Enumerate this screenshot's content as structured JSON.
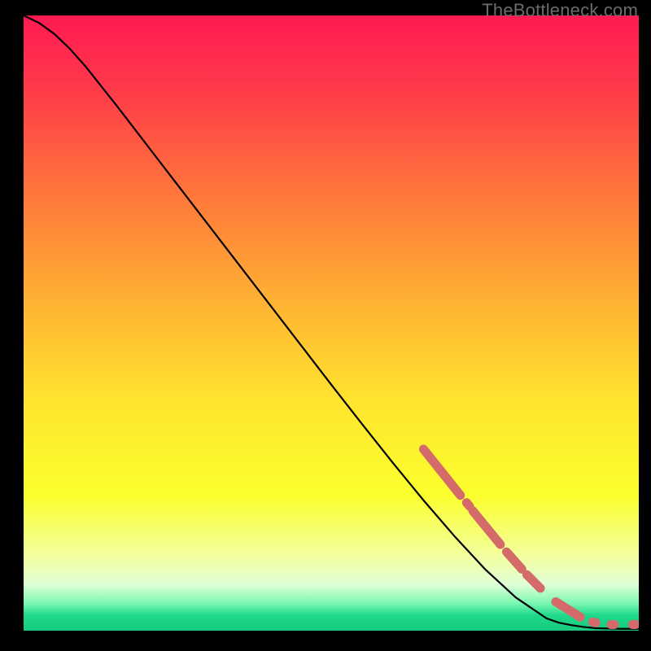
{
  "watermark": "TheBottleneck.com",
  "chart_data": {
    "type": "line",
    "title": "",
    "xlabel": "",
    "ylabel": "",
    "xlim": [
      0,
      100
    ],
    "ylim": [
      0,
      100
    ],
    "grid": false,
    "legend": false,
    "gradient_stops": [
      {
        "offset": 0.0,
        "color": "#ff1a52"
      },
      {
        "offset": 0.12,
        "color": "#ff3a4a"
      },
      {
        "offset": 0.3,
        "color": "#ff7a3a"
      },
      {
        "offset": 0.48,
        "color": "#ffb733"
      },
      {
        "offset": 0.63,
        "color": "#ffe52e"
      },
      {
        "offset": 0.78,
        "color": "#fbff2d"
      },
      {
        "offset": 0.88,
        "color": "#f3ffa0"
      },
      {
        "offset": 0.925,
        "color": "#dfffd6"
      },
      {
        "offset": 0.955,
        "color": "#7df7b4"
      },
      {
        "offset": 0.975,
        "color": "#1fd98a"
      },
      {
        "offset": 1.0,
        "color": "#16c97e"
      }
    ],
    "series": [
      {
        "name": "main-curve",
        "color": "#000000",
        "stroke_width": 2.2,
        "x": [
          0.0,
          2.5,
          5.0,
          7.5,
          10.0,
          15.0,
          20.0,
          25.0,
          30.0,
          35.0,
          40.0,
          45.0,
          50.0,
          55.0,
          60.0,
          65.0,
          70.0,
          75.0,
          80.0,
          85.0,
          87.0,
          89.0,
          91.0,
          93.0,
          95.0,
          97.0,
          100.0
        ],
        "y": [
          100.0,
          98.8,
          97.0,
          94.6,
          91.8,
          85.5,
          79.0,
          72.5,
          66.0,
          59.5,
          53.0,
          46.5,
          40.0,
          33.6,
          27.3,
          21.2,
          15.4,
          10.0,
          5.4,
          2.0,
          1.3,
          0.9,
          0.6,
          0.4,
          0.35,
          0.3,
          0.3
        ]
      },
      {
        "name": "highlight-segments",
        "color": "#d46a6a",
        "stroke_width": 11,
        "linecap": "round",
        "segments": [
          {
            "x": [
              65.0,
              71.0
            ],
            "y": [
              29.5,
              22.0
            ]
          },
          {
            "x": [
              72.0,
              72.5
            ],
            "y": [
              20.8,
              20.2
            ]
          },
          {
            "x": [
              73.0,
              77.5
            ],
            "y": [
              19.5,
              14.0
            ]
          },
          {
            "x": [
              78.5,
              81.0
            ],
            "y": [
              12.8,
              10.0
            ]
          },
          {
            "x": [
              81.8,
              84.0
            ],
            "y": [
              9.1,
              6.9
            ]
          },
          {
            "x": [
              86.5,
              90.5
            ],
            "y": [
              4.7,
              2.2
            ]
          },
          {
            "x": [
              92.5,
              93.0
            ],
            "y": [
              1.4,
              1.3
            ]
          },
          {
            "x": [
              95.5,
              96.0
            ],
            "y": [
              1.0,
              1.0
            ]
          },
          {
            "x": [
              99.0,
              99.5
            ],
            "y": [
              1.0,
              1.0
            ]
          }
        ]
      }
    ]
  }
}
